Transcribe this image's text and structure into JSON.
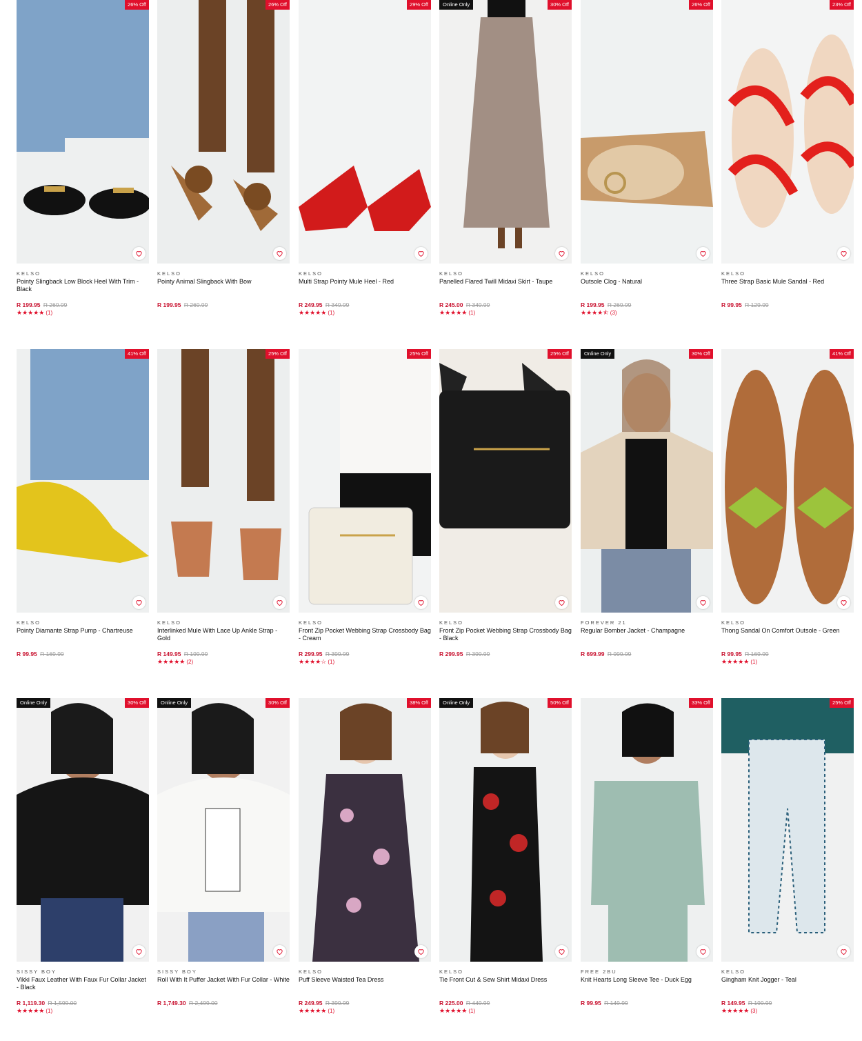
{
  "colors": {
    "sale_price": "#c8102e",
    "badge": "#e0102c",
    "online_badge": "#111111",
    "star": "#e0102c"
  },
  "products": [
    {
      "discount": "26% Off",
      "online": "",
      "brand": "KELSO",
      "name": "Pointy Slingback Low Block Heel With Trim - Black",
      "price": "R 199.95",
      "was": "R 269.99",
      "stars": "★★★★★",
      "reviews": "(1)",
      "image": "black-slingback-heel"
    },
    {
      "discount": "26% Off",
      "online": "",
      "brand": "KELSO",
      "name": "Pointy Animal Slingback With Bow",
      "price": "R 199.95",
      "was": "R 269.99",
      "stars": "",
      "reviews": "",
      "image": "leopard-bow-flat"
    },
    {
      "discount": "29% Off",
      "online": "",
      "brand": "KELSO",
      "name": "Multi Strap Pointy Mule Heel - Red",
      "price": "R 249.95",
      "was": "R 349.99",
      "stars": "★★★★★",
      "reviews": "(1)",
      "image": "red-mule-heel"
    },
    {
      "discount": "30% Off",
      "online": "Online Only",
      "brand": "KELSO",
      "name": "Panelled Flared Twill Midaxi Skirt - Taupe",
      "price": "R 245.00",
      "was": "R 349.99",
      "stars": "★★★★★",
      "reviews": "(1)",
      "image": "taupe-skirt"
    },
    {
      "discount": "26% Off",
      "online": "",
      "brand": "KELSO",
      "name": "Outsole Clog - Natural",
      "price": "R 199.95",
      "was": "R 269.99",
      "stars": "★★★★⯪",
      "reviews": "(3)",
      "image": "natural-clog"
    },
    {
      "discount": "23% Off",
      "online": "",
      "brand": "KELSO",
      "name": "Three Strap Basic Mule Sandal - Red",
      "price": "R 99.95",
      "was": "R 129.99",
      "stars": "",
      "reviews": "",
      "image": "red-strap-sandal"
    },
    {
      "discount": "41% Off",
      "online": "",
      "brand": "KELSO",
      "name": "Pointy Diamante Strap Pump - Chartreuse",
      "price": "R 99.95",
      "was": "R 169.99",
      "stars": "",
      "reviews": "",
      "image": "chartreuse-pump"
    },
    {
      "discount": "25% Off",
      "online": "",
      "brand": "KELSO",
      "name": "Interlinked Mule With Lace Up Ankle Strap - Gold",
      "price": "R 149.95",
      "was": "R 199.99",
      "stars": "★★★★★",
      "reviews": "(2)",
      "image": "gold-strap-sandal"
    },
    {
      "discount": "25% Off",
      "online": "",
      "brand": "KELSO",
      "name": "Front Zip Pocket Webbing Strap Crossbody Bag - Cream",
      "price": "R 299.95",
      "was": "R 399.99",
      "stars": "★★★★☆",
      "reviews": "(1)",
      "image": "cream-crossbody-bag"
    },
    {
      "discount": "25% Off",
      "online": "",
      "brand": "KELSO",
      "name": "Front Zip Pocket Webbing Strap Crossbody Bag - Black",
      "price": "R 299.95",
      "was": "R 399.99",
      "stars": "",
      "reviews": "",
      "image": "black-crossbody-bag"
    },
    {
      "discount": "30% Off",
      "online": "Online Only",
      "brand": "FOREVER 21",
      "name": "Regular Bomber Jacket - Champagne",
      "price": "R 699.99",
      "was": "R 999.99",
      "stars": "",
      "reviews": "",
      "image": "champagne-bomber"
    },
    {
      "discount": "41% Off",
      "online": "",
      "brand": "KELSO",
      "name": "Thong Sandal On Comfort Outsole - Green",
      "price": "R 99.95",
      "was": "R 169.99",
      "stars": "★★★★★",
      "reviews": "(1)",
      "image": "green-bow-sandal"
    },
    {
      "discount": "30% Off",
      "online": "Online Only",
      "brand": "SISSY BOY",
      "name": "Vikki Faux Leather With Faux Fur Collar Jacket - Black",
      "price": "R 1,119.30",
      "was": "R 1,599.00",
      "stars": "★★★★★",
      "reviews": "(1)",
      "image": "black-fur-jacket"
    },
    {
      "discount": "30% Off",
      "online": "Online Only",
      "brand": "SISSY BOY",
      "name": "Roll With It Puffer Jacket With Fur Collar - White",
      "price": "R 1,749.30",
      "was": "R 2,499.00",
      "stars": "",
      "reviews": "",
      "image": "white-puffer"
    },
    {
      "discount": "38% Off",
      "online": "",
      "brand": "KELSO",
      "name": "Puff Sleeve Waisted Tea Dress",
      "price": "R 249.95",
      "was": "R 399.99",
      "stars": "★★★★★",
      "reviews": "(1)",
      "image": "floral-tea-dress"
    },
    {
      "discount": "50% Off",
      "online": "Online Only",
      "brand": "KELSO",
      "name": "Tie Front Cut & Sew Shirt Midaxi Dress",
      "price": "R 225.00",
      "was": "R 449.99",
      "stars": "★★★★★",
      "reviews": "(1)",
      "image": "red-floral-dress"
    },
    {
      "discount": "33% Off",
      "online": "",
      "brand": "FREE 2BU",
      "name": "Knit Hearts Long Sleeve Tee - Duck Egg",
      "price": "R 99.95",
      "was": "R 149.99",
      "stars": "",
      "reviews": "",
      "image": "hearts-tee"
    },
    {
      "discount": "25% Off",
      "online": "",
      "brand": "KELSO",
      "name": "Gingham Knit Jogger - Teal",
      "price": "R 149.95",
      "was": "R 199.99",
      "stars": "★★★★★",
      "reviews": "(3)",
      "image": "gingham-jogger"
    }
  ]
}
